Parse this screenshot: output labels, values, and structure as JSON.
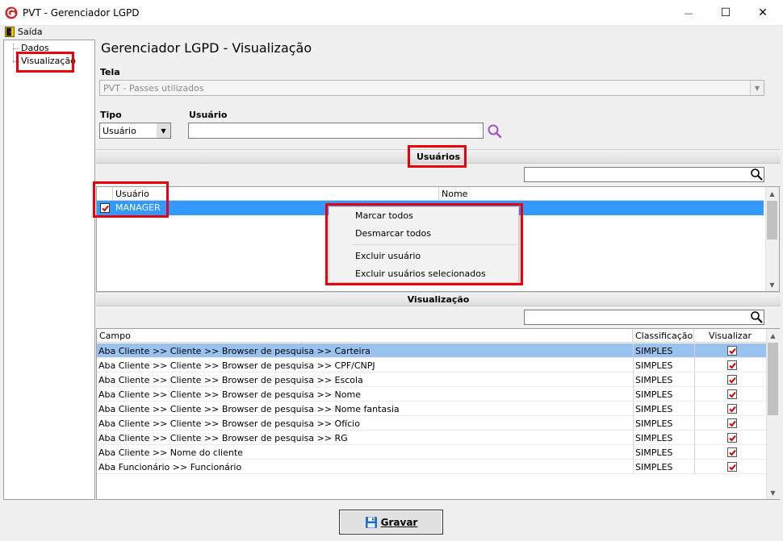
{
  "window": {
    "title": "PVT - Gerenciador LGPD",
    "minimize": "—",
    "maximize": "☐",
    "close": "✕"
  },
  "menu": {
    "exit_label": "Saída"
  },
  "tree": {
    "items": [
      "Dados",
      "Visualização"
    ]
  },
  "page": {
    "title": "Gerenciador LGPD - Visualização"
  },
  "tela": {
    "label": "Tela",
    "value": "PVT - Passes utilizados"
  },
  "tipo": {
    "label": "Tipo",
    "value": "Usuário"
  },
  "usuario": {
    "label": "Usuário",
    "value": ""
  },
  "users_section": {
    "title": "Usuários",
    "columns": [
      "Usuário",
      "Nome"
    ],
    "rows": [
      {
        "usuario": "MANAGER",
        "nome": "",
        "checked": true
      }
    ]
  },
  "context_menu": {
    "items": [
      "Marcar todos",
      "Desmarcar todos",
      "Excluir usuário",
      "Excluir usuários selecionados"
    ]
  },
  "vis_section": {
    "title": "Visualização",
    "columns": [
      "Campo",
      "Classificação",
      "Visualizar"
    ],
    "rows": [
      {
        "campo": "Aba Cliente >> Cliente >> Browser de pesquisa >> Carteira",
        "classificacao": "SIMPLES",
        "visualizar": true
      },
      {
        "campo": "Aba Cliente >> Cliente >> Browser de pesquisa >> CPF/CNPJ",
        "classificacao": "SIMPLES",
        "visualizar": true
      },
      {
        "campo": "Aba Cliente >> Cliente >> Browser de pesquisa >> Escola",
        "classificacao": "SIMPLES",
        "visualizar": true
      },
      {
        "campo": "Aba Cliente >> Cliente >> Browser de pesquisa >> Nome",
        "classificacao": "SIMPLES",
        "visualizar": true
      },
      {
        "campo": "Aba Cliente >> Cliente >> Browser de pesquisa >> Nome fantasia",
        "classificacao": "SIMPLES",
        "visualizar": true
      },
      {
        "campo": "Aba Cliente >> Cliente >> Browser de pesquisa >> Ofício",
        "classificacao": "SIMPLES",
        "visualizar": true
      },
      {
        "campo": "Aba Cliente >> Cliente >> Browser de pesquisa >> RG",
        "classificacao": "SIMPLES",
        "visualizar": true
      },
      {
        "campo": "Aba Cliente >> Nome do cliente",
        "classificacao": "SIMPLES",
        "visualizar": true
      },
      {
        "campo": "Aba Funcionário >> Funcionário",
        "classificacao": "SIMPLES",
        "visualizar": true
      }
    ]
  },
  "save_button": {
    "label": "Gravar"
  },
  "colors": {
    "accent": "#3399ff",
    "selected_row": "#99c2ef",
    "annotation": "#e8000b",
    "check": "#d40000"
  }
}
